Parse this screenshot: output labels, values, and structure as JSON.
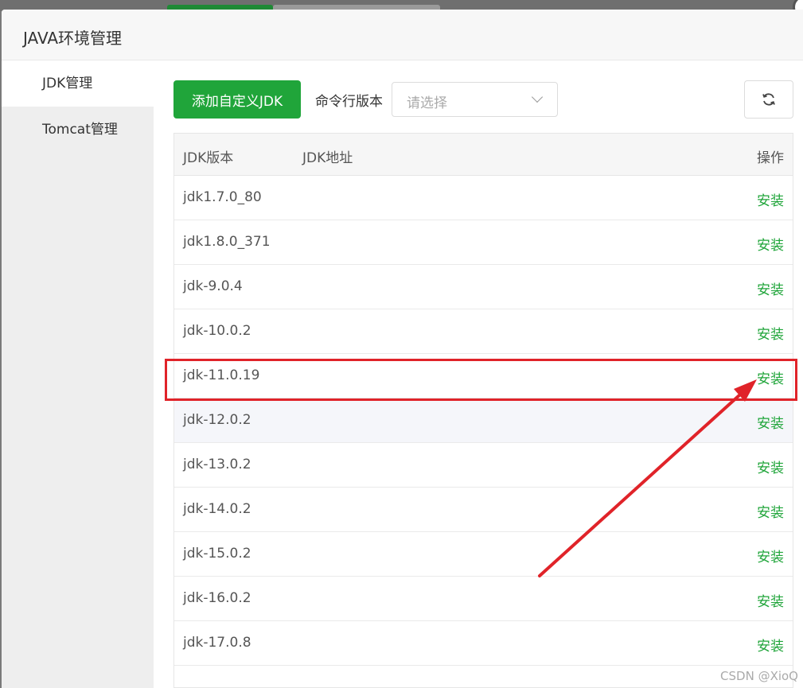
{
  "dialog": {
    "title": "JAVA环境管理"
  },
  "sidebar": {
    "items": [
      {
        "label": "JDK管理",
        "active": true
      },
      {
        "label": "Tomcat管理",
        "active": false
      }
    ]
  },
  "toolbar": {
    "add_label": "添加自定义JDK",
    "cli_label": "命令行版本",
    "select_placeholder": "请选择",
    "refresh_icon": "refresh-icon"
  },
  "table": {
    "headers": {
      "version": "JDK版本",
      "path": "JDK地址",
      "action": "操作"
    },
    "rows": [
      {
        "version": "jdk1.7.0_80",
        "path": "",
        "action": "安装"
      },
      {
        "version": "jdk1.8.0_371",
        "path": "",
        "action": "安装"
      },
      {
        "version": "jdk-9.0.4",
        "path": "",
        "action": "安装"
      },
      {
        "version": "jdk-10.0.2",
        "path": "",
        "action": "安装"
      },
      {
        "version": "jdk-11.0.19",
        "path": "",
        "action": "安装"
      },
      {
        "version": "jdk-12.0.2",
        "path": "",
        "action": "安装"
      },
      {
        "version": "jdk-13.0.2",
        "path": "",
        "action": "安装"
      },
      {
        "version": "jdk-14.0.2",
        "path": "",
        "action": "安装"
      },
      {
        "version": "jdk-15.0.2",
        "path": "",
        "action": "安装"
      },
      {
        "version": "jdk-16.0.2",
        "path": "",
        "action": "安装"
      },
      {
        "version": "jdk-17.0.8",
        "path": "",
        "action": "安装"
      }
    ]
  },
  "colors": {
    "accent": "#20a53a",
    "annotation": "#e02329"
  },
  "watermark": "CSDN @XioQ"
}
